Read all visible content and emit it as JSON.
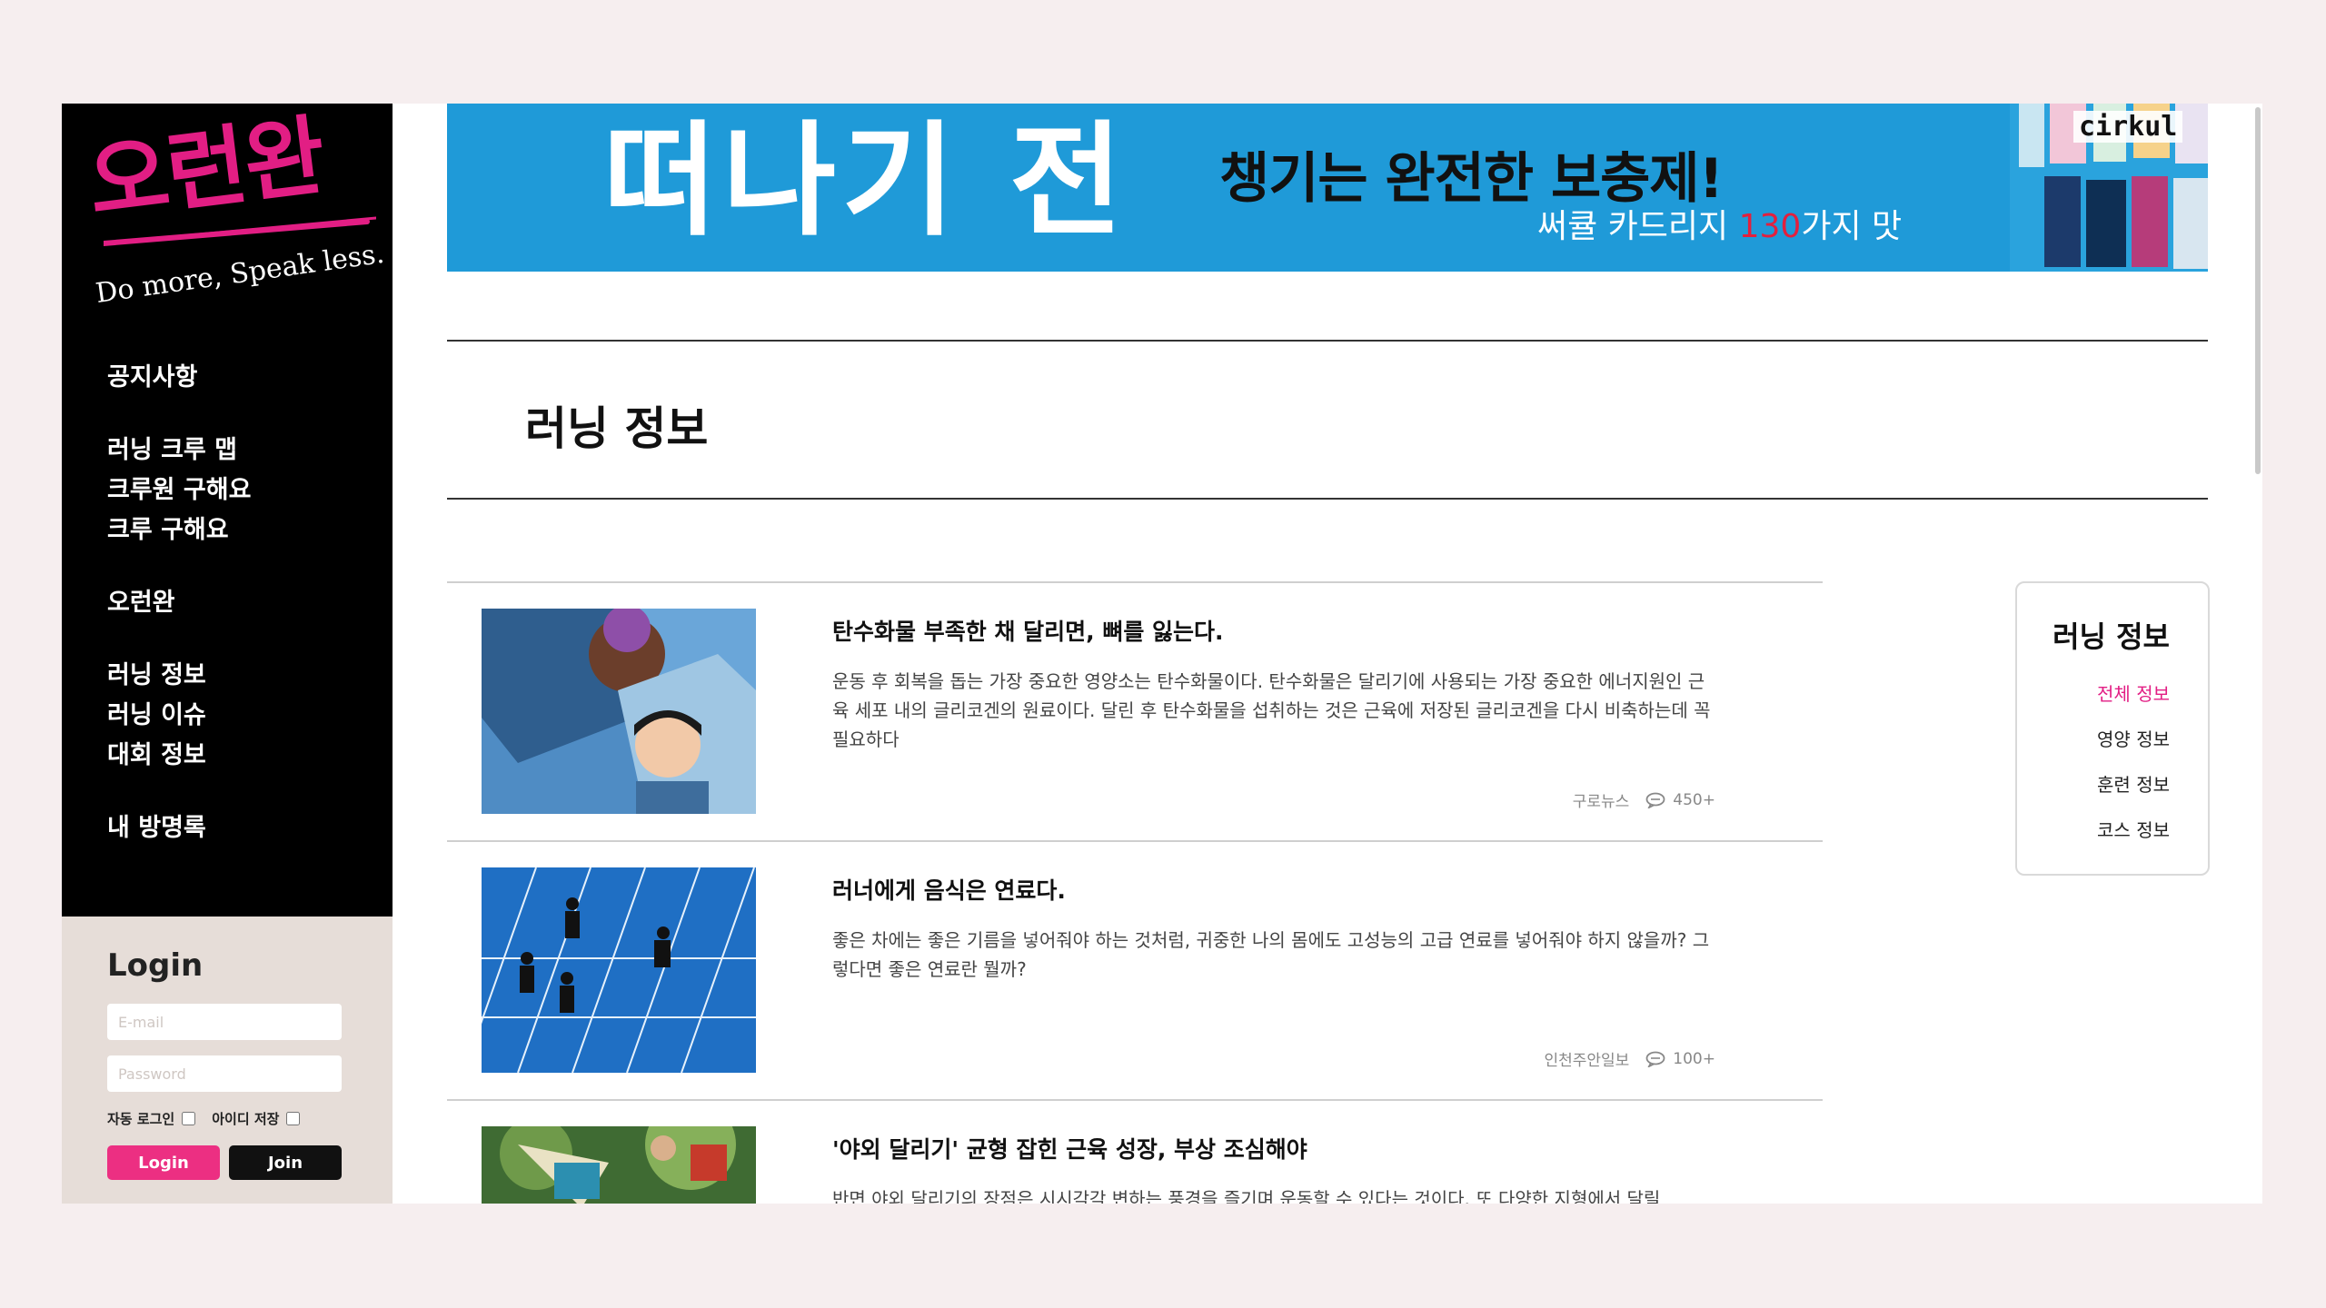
{
  "brand": {
    "logo_text": "오런완",
    "tagline": "Do more, Speak less.",
    "accent": "#e21e84"
  },
  "sidebar": {
    "groups": [
      {
        "items": [
          {
            "label": "공지사항"
          }
        ]
      },
      {
        "items": [
          {
            "label": "러닝 크루 맵"
          },
          {
            "label": "크루원 구해요"
          },
          {
            "label": "크루 구해요"
          }
        ]
      },
      {
        "items": [
          {
            "label": "오런완"
          }
        ]
      },
      {
        "items": [
          {
            "label": "러닝 정보"
          },
          {
            "label": "러닝 이슈"
          },
          {
            "label": "대회 정보"
          }
        ]
      },
      {
        "items": [
          {
            "label": "내 방명록"
          }
        ]
      }
    ]
  },
  "login": {
    "title": "Login",
    "email_placeholder": "E-mail",
    "password_placeholder": "Password",
    "auto_login_label": "자동 로그인",
    "save_id_label": "아이디 저장",
    "login_label": "Login",
    "join_label": "Join",
    "login_color": "#ec2f82"
  },
  "banner": {
    "headline": "떠나기 전",
    "subhead": "챙기는 완전한 보충제!",
    "line_prefix": "써큘 카드리지 ",
    "line_number": "130",
    "line_suffix": "가지 맛",
    "brand": "cirkul",
    "background": "#1f9ad8"
  },
  "page": {
    "title": "러닝 정보"
  },
  "articles": [
    {
      "title": "탄수화물 부족한 채 달리면, 뼈를 잃는다.",
      "desc": "운동 후 회복을 돕는 가장 중요한 영양소는 탄수화물이다. 탄수화물은 달리기에 사용되는 가장 중요한 에너지원인 근육 세포 내의 글리코겐의 원료이다. 달린 후 탄수화물을 섭취하는 것은 근육에 저장된 글리코겐을 다시 비축하는데 꼭 필요하다",
      "source": "구로뉴스",
      "comments": "450+"
    },
    {
      "title": "러너에게 음식은 연료다.",
      "desc": "좋은 차에는 좋은 기름을 넣어줘야 하는 것처럼, 귀중한 나의 몸에도 고성능의 고급 연료를 넣어줘야 하지 않을까? 그렇다면 좋은 연료란 뭘까?",
      "source": "인천주안일보",
      "comments": "100+"
    },
    {
      "title": "'야외 달리기' 균형 잡힌 근육 성장, 부상 조심해야",
      "desc": "반면 야외 달리기의 장점은 시시각각 변하는 풍경을 즐기며 운동할 수 있다는 것이다. 또 다양한 지형에서 달릴",
      "source": "",
      "comments": ""
    }
  ],
  "side_card": {
    "title": "러닝 정보",
    "links": [
      {
        "label": "전체 정보"
      },
      {
        "label": "영양 정보"
      },
      {
        "label": "훈련 정보"
      },
      {
        "label": "코스 정보"
      }
    ]
  }
}
